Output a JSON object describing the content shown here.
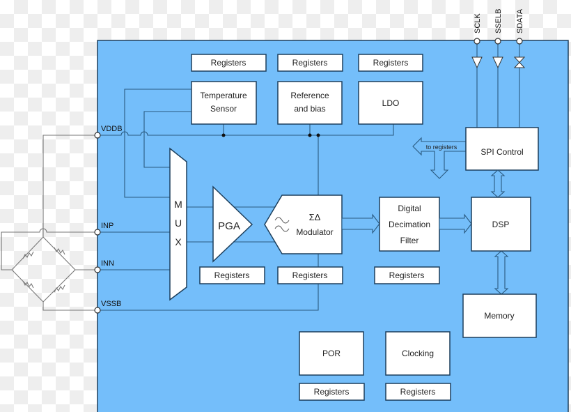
{
  "colors": {
    "chip_background": "#74befa",
    "block_fill": "#ffffff",
    "outline": "#1d3f5c"
  },
  "pins": {
    "vddb": "VDDB",
    "inp": "INP",
    "inn": "INN",
    "vssb": "VSSB",
    "sclk": "SCLK",
    "sselb": "SSELB",
    "sdata": "SDATA"
  },
  "blocks": {
    "temp_sensor": [
      "Temperature",
      "Sensor"
    ],
    "reference": [
      "Reference",
      "and bias"
    ],
    "ldo": "LDO",
    "spi": "SPI Control",
    "to_registers": "to registers",
    "mux": [
      "M",
      "U",
      "X"
    ],
    "pga": "PGA",
    "modulator_symbol": "ΣΔ",
    "modulator": "Modulator",
    "filter": [
      "Digital",
      "Decimation",
      "Filter"
    ],
    "dsp": "DSP",
    "memory": "Memory",
    "por": "POR",
    "clocking": "Clocking"
  },
  "registers_label": "Registers"
}
